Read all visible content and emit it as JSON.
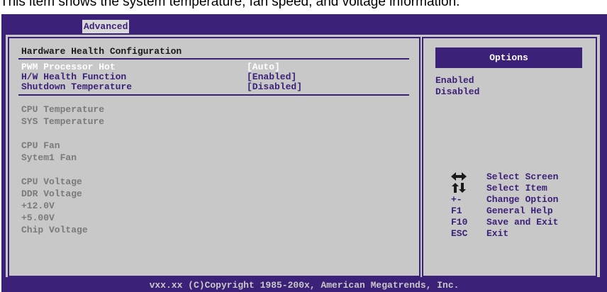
{
  "caption": "This item shows the system temperature, fan speed, and voltage information.",
  "tab": {
    "label": "Advanced"
  },
  "section_title": "Hardware Health Configuration",
  "settings": [
    {
      "label": "PWM Processor Hot",
      "value": "[Auto]"
    },
    {
      "label": "H/W Health Function",
      "value": "[Enabled]"
    },
    {
      "label": "Shutdown Temperature",
      "value": "[Disabled]"
    }
  ],
  "monitor": {
    "cpu_temp": "CPU Temperature",
    "sys_temp": "SYS Temperature",
    "cpu_fan": "CPU Fan",
    "system1_fan": "Sytem1 Fan",
    "cpu_voltage": "CPU Voltage",
    "ddr_voltage": "DDR Voltage",
    "v12": "+12.0V",
    "v5": "+5.00V",
    "chip_voltage": "Chip Voltage"
  },
  "options": {
    "title": "Options",
    "items": [
      "Enabled",
      "Disabled"
    ]
  },
  "help": [
    {
      "key": "",
      "icon": "arrows-horizontal-icon",
      "desc": "Select Screen"
    },
    {
      "key": "",
      "icon": "arrows-vertical-icon",
      "desc": "Select Item"
    },
    {
      "key": "+-",
      "desc": "Change Option"
    },
    {
      "key": "F1",
      "desc": "General Help"
    },
    {
      "key": "F10",
      "desc": "Save and Exit"
    },
    {
      "key": "ESC",
      "desc": "Exit"
    }
  ],
  "footer": "vxx.xx (C)Copyright 1985-200x, American Megatrends, Inc.",
  "colors": {
    "frame": "#3c2178",
    "panel": "#c8c8c8",
    "selected": "#ffffff",
    "disabled_text": "#7a7a7a"
  }
}
